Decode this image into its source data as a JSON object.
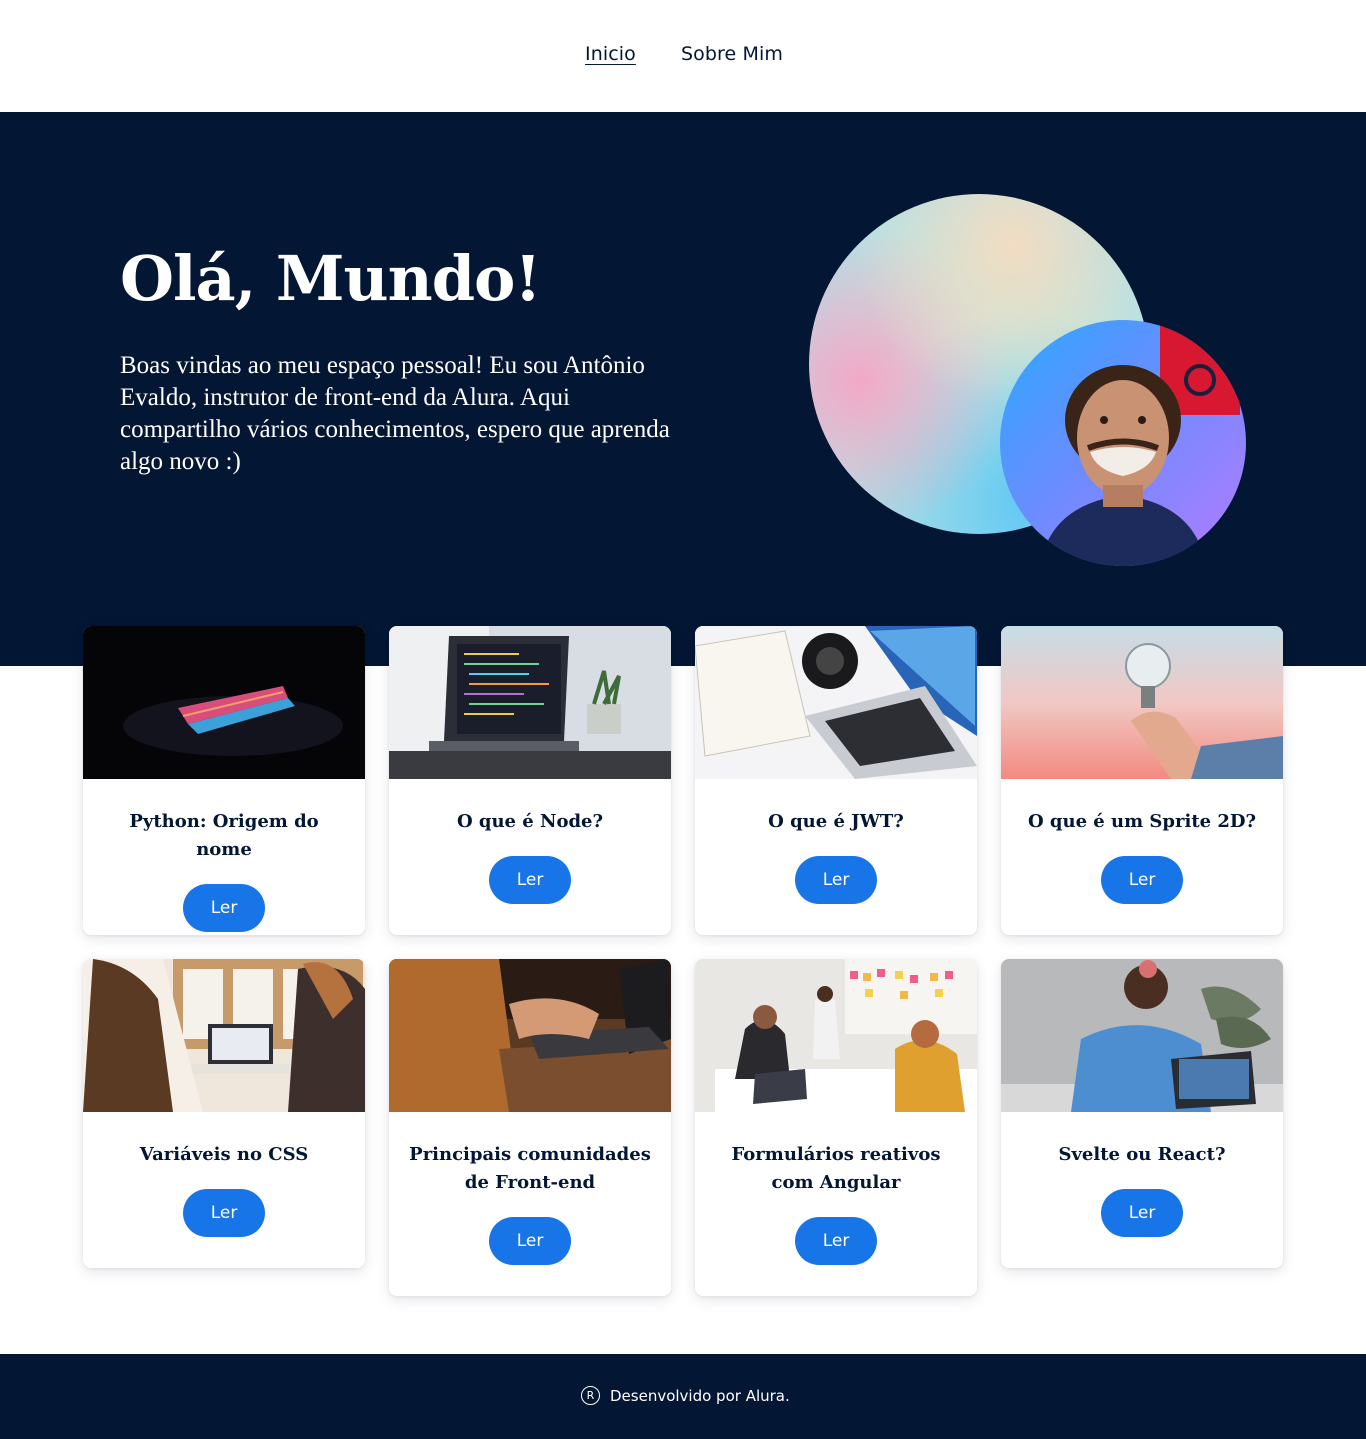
{
  "nav": {
    "home": "Inicio",
    "about": "Sobre Mim"
  },
  "hero": {
    "title": "Olá, Mundo!",
    "text": "Boas vindas ao meu espaço pessoal! Eu sou Antônio Evaldo, instrutor de front-end da Alura. Aqui compartilho vários conhecimentos, espero que aprenda algo novo :)"
  },
  "cards": [
    {
      "title": "Python: Origem do nome",
      "button": "Ler"
    },
    {
      "title": "O que é Node?",
      "button": "Ler"
    },
    {
      "title": "O que é JWT?",
      "button": "Ler"
    },
    {
      "title": "O que é um Sprite 2D?",
      "button": "Ler"
    },
    {
      "title": "Variáveis no CSS",
      "button": "Ler"
    },
    {
      "title": "Principais comunidades de Front-end",
      "button": "Ler"
    },
    {
      "title": "Formulários reativos com Angular",
      "button": "Ler"
    },
    {
      "title": "Svelte ou React?",
      "button": "Ler"
    }
  ],
  "footer": {
    "icon": "registered-icon",
    "text": "Desenvolvido por Alura."
  },
  "colors": {
    "navy": "#031634",
    "button": "#1875e8"
  }
}
